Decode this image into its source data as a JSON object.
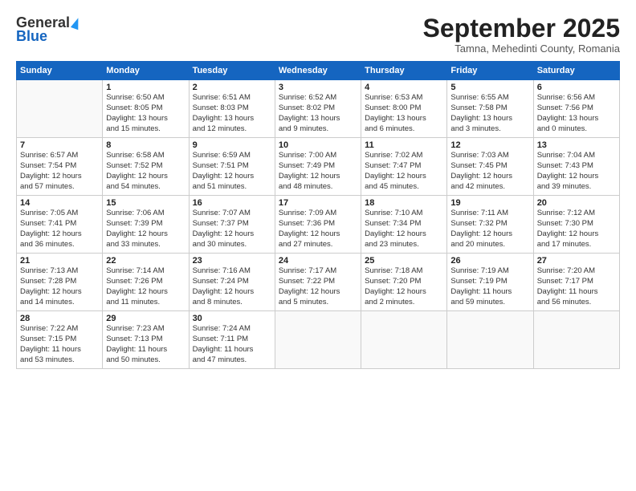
{
  "header": {
    "logo_general": "General",
    "logo_blue": "Blue",
    "month_title": "September 2025",
    "location": "Tamna, Mehedinti County, Romania"
  },
  "weekdays": [
    "Sunday",
    "Monday",
    "Tuesday",
    "Wednesday",
    "Thursday",
    "Friday",
    "Saturday"
  ],
  "weeks": [
    [
      {
        "day": "",
        "info": ""
      },
      {
        "day": "1",
        "info": "Sunrise: 6:50 AM\nSunset: 8:05 PM\nDaylight: 13 hours\nand 15 minutes."
      },
      {
        "day": "2",
        "info": "Sunrise: 6:51 AM\nSunset: 8:03 PM\nDaylight: 13 hours\nand 12 minutes."
      },
      {
        "day": "3",
        "info": "Sunrise: 6:52 AM\nSunset: 8:02 PM\nDaylight: 13 hours\nand 9 minutes."
      },
      {
        "day": "4",
        "info": "Sunrise: 6:53 AM\nSunset: 8:00 PM\nDaylight: 13 hours\nand 6 minutes."
      },
      {
        "day": "5",
        "info": "Sunrise: 6:55 AM\nSunset: 7:58 PM\nDaylight: 13 hours\nand 3 minutes."
      },
      {
        "day": "6",
        "info": "Sunrise: 6:56 AM\nSunset: 7:56 PM\nDaylight: 13 hours\nand 0 minutes."
      }
    ],
    [
      {
        "day": "7",
        "info": "Sunrise: 6:57 AM\nSunset: 7:54 PM\nDaylight: 12 hours\nand 57 minutes."
      },
      {
        "day": "8",
        "info": "Sunrise: 6:58 AM\nSunset: 7:52 PM\nDaylight: 12 hours\nand 54 minutes."
      },
      {
        "day": "9",
        "info": "Sunrise: 6:59 AM\nSunset: 7:51 PM\nDaylight: 12 hours\nand 51 minutes."
      },
      {
        "day": "10",
        "info": "Sunrise: 7:00 AM\nSunset: 7:49 PM\nDaylight: 12 hours\nand 48 minutes."
      },
      {
        "day": "11",
        "info": "Sunrise: 7:02 AM\nSunset: 7:47 PM\nDaylight: 12 hours\nand 45 minutes."
      },
      {
        "day": "12",
        "info": "Sunrise: 7:03 AM\nSunset: 7:45 PM\nDaylight: 12 hours\nand 42 minutes."
      },
      {
        "day": "13",
        "info": "Sunrise: 7:04 AM\nSunset: 7:43 PM\nDaylight: 12 hours\nand 39 minutes."
      }
    ],
    [
      {
        "day": "14",
        "info": "Sunrise: 7:05 AM\nSunset: 7:41 PM\nDaylight: 12 hours\nand 36 minutes."
      },
      {
        "day": "15",
        "info": "Sunrise: 7:06 AM\nSunset: 7:39 PM\nDaylight: 12 hours\nand 33 minutes."
      },
      {
        "day": "16",
        "info": "Sunrise: 7:07 AM\nSunset: 7:37 PM\nDaylight: 12 hours\nand 30 minutes."
      },
      {
        "day": "17",
        "info": "Sunrise: 7:09 AM\nSunset: 7:36 PM\nDaylight: 12 hours\nand 27 minutes."
      },
      {
        "day": "18",
        "info": "Sunrise: 7:10 AM\nSunset: 7:34 PM\nDaylight: 12 hours\nand 23 minutes."
      },
      {
        "day": "19",
        "info": "Sunrise: 7:11 AM\nSunset: 7:32 PM\nDaylight: 12 hours\nand 20 minutes."
      },
      {
        "day": "20",
        "info": "Sunrise: 7:12 AM\nSunset: 7:30 PM\nDaylight: 12 hours\nand 17 minutes."
      }
    ],
    [
      {
        "day": "21",
        "info": "Sunrise: 7:13 AM\nSunset: 7:28 PM\nDaylight: 12 hours\nand 14 minutes."
      },
      {
        "day": "22",
        "info": "Sunrise: 7:14 AM\nSunset: 7:26 PM\nDaylight: 12 hours\nand 11 minutes."
      },
      {
        "day": "23",
        "info": "Sunrise: 7:16 AM\nSunset: 7:24 PM\nDaylight: 12 hours\nand 8 minutes."
      },
      {
        "day": "24",
        "info": "Sunrise: 7:17 AM\nSunset: 7:22 PM\nDaylight: 12 hours\nand 5 minutes."
      },
      {
        "day": "25",
        "info": "Sunrise: 7:18 AM\nSunset: 7:20 PM\nDaylight: 12 hours\nand 2 minutes."
      },
      {
        "day": "26",
        "info": "Sunrise: 7:19 AM\nSunset: 7:19 PM\nDaylight: 11 hours\nand 59 minutes."
      },
      {
        "day": "27",
        "info": "Sunrise: 7:20 AM\nSunset: 7:17 PM\nDaylight: 11 hours\nand 56 minutes."
      }
    ],
    [
      {
        "day": "28",
        "info": "Sunrise: 7:22 AM\nSunset: 7:15 PM\nDaylight: 11 hours\nand 53 minutes."
      },
      {
        "day": "29",
        "info": "Sunrise: 7:23 AM\nSunset: 7:13 PM\nDaylight: 11 hours\nand 50 minutes."
      },
      {
        "day": "30",
        "info": "Sunrise: 7:24 AM\nSunset: 7:11 PM\nDaylight: 11 hours\nand 47 minutes."
      },
      {
        "day": "",
        "info": ""
      },
      {
        "day": "",
        "info": ""
      },
      {
        "day": "",
        "info": ""
      },
      {
        "day": "",
        "info": ""
      }
    ]
  ]
}
